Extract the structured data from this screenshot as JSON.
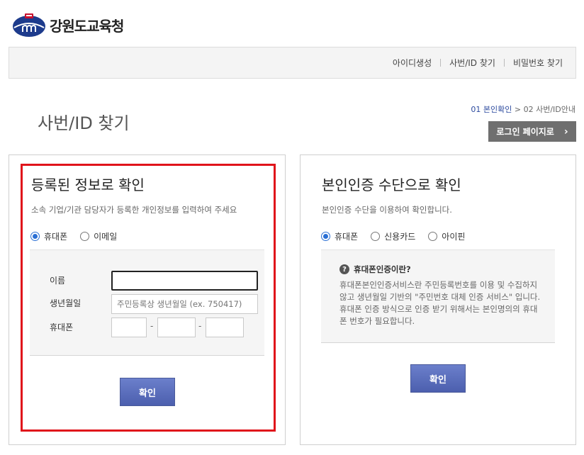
{
  "header": {
    "logo_text": "강원도교육청",
    "nav": [
      "아이디생성",
      "사번/ID 찾기",
      "비밀번호 찾기"
    ]
  },
  "page": {
    "title": "사번/ID 찾기",
    "step_active": "01 본인확인",
    "step_sep": ">",
    "step_next": "02 사번/ID안내",
    "login_button": "로그인 페이지로"
  },
  "left_panel": {
    "title": "등록된 정보로 확인",
    "desc": "소속 기업/기관 담당자가 등록한 개인정보를 입력하여 주세요",
    "options": [
      {
        "label": "휴대폰",
        "checked": true
      },
      {
        "label": "이메일",
        "checked": false
      }
    ],
    "fields": {
      "name_label": "이름",
      "name_value": "",
      "birth_label": "생년월일",
      "birth_placeholder": "주민등록상 생년월일 (ex. 750417)",
      "phone_label": "휴대폰",
      "phone_sep": "-"
    },
    "confirm": "확인"
  },
  "right_panel": {
    "title": "본인인증 수단으로 확인",
    "desc": "본인인증 수단을 이용하여 확인합니다.",
    "options": [
      {
        "label": "휴대폰",
        "checked": true
      },
      {
        "label": "신용카드",
        "checked": false
      },
      {
        "label": "아이핀",
        "checked": false
      }
    ],
    "info_title": "휴대폰인증이란?",
    "info_text": "휴대폰본인인증서비스란 주민등록번호를 이용 및 수집하지 않고 생년월일 기반의 \"주민번호 대체 인증 서비스\" 입니다. 휴대폰 인증 방식으로 인증 받기 위해서는 본인명의의 휴대폰 번호가 필요합니다.",
    "confirm": "확인"
  },
  "colors": {
    "accent": "#2c4a9e",
    "highlight": "#e0141b",
    "button": "#5566b8"
  }
}
